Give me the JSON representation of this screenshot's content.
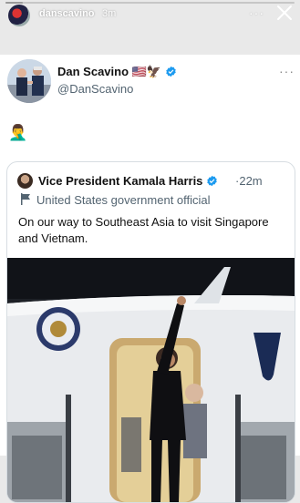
{
  "story": {
    "username": "danscavino",
    "time": "3m",
    "more": "···",
    "progress": 0.06
  },
  "tweet": {
    "author_name": "Dan Scavino",
    "author_name_suffix": "🇺🇸🦅",
    "handle": "@DanScavino",
    "more": "···",
    "body": "🤦‍♂️"
  },
  "quote": {
    "name": "Vice President Kamala Harris",
    "separator": "·",
    "time": "22m",
    "label": "United States government official",
    "text": "On our way to Southeast Asia to visit Singapore and Vietnam."
  },
  "colors": {
    "verified": "#1d9bf0",
    "text_secondary": "#536471",
    "story_bg": "#e9e9e9"
  },
  "icons": {
    "verified": "verified-badge-icon",
    "flag": "government-flag-icon",
    "close": "close-icon",
    "more": "more-icon"
  }
}
